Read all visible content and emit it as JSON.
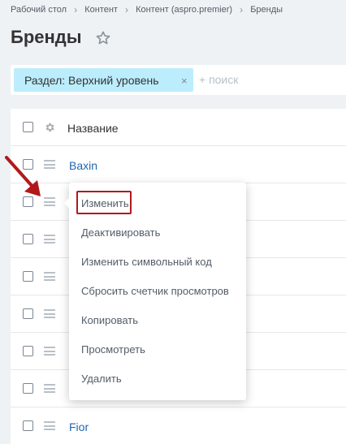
{
  "breadcrumb": [
    "Рабочий стол",
    "Контент",
    "Контент (aspro.premier)",
    "Бренды"
  ],
  "page": {
    "title": "Бренды"
  },
  "filter": {
    "chip_label": "Раздел: Верхний уровень",
    "close_glyph": "×",
    "search_placeholder": "+ поиск"
  },
  "grid": {
    "header": "Название",
    "rows": [
      "Baxin",
      "",
      "",
      "",
      "",
      "",
      "",
      "Fior"
    ]
  },
  "context_menu": {
    "items": [
      "Изменить",
      "Деактивировать",
      "Изменить символьный код",
      "Сбросить счетчик просмотров",
      "Копировать",
      "Просмотреть",
      "Удалить"
    ],
    "highlighted_item": "Изменить"
  },
  "colors": {
    "accent_link": "#2067b0",
    "filter_chip": "#bcedfc",
    "annotation_red": "#b2191c"
  },
  "icons": [
    "star-icon",
    "gear-icon",
    "drag-handle-icon",
    "close-icon",
    "arrow-annotation"
  ]
}
